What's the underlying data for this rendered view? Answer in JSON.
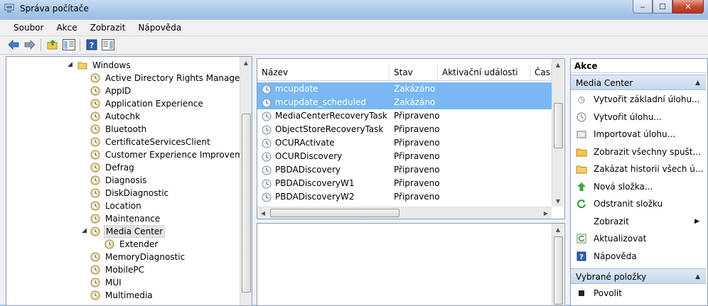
{
  "window": {
    "title": "Správa počítače",
    "min": "‒",
    "max": "☐",
    "close": "✕"
  },
  "menu": [
    "Soubor",
    "Akce",
    "Zobrazit",
    "Nápověda"
  ],
  "tree": {
    "root": "Windows",
    "items": [
      "Active Directory Rights Managemer",
      "AppID",
      "Application Experience",
      "Autochk",
      "Bluetooth",
      "CertificateServicesClient",
      "Customer Experience Improvement",
      "Defrag",
      "Diagnosis",
      "DiskDiagnostic",
      "Location",
      "Maintenance",
      "Media Center",
      "Extender",
      "MemoryDiagnostic",
      "MobilePC",
      "MUI",
      "Multimedia"
    ]
  },
  "list": {
    "columns": [
      "Název",
      "Stav",
      "Aktivační události",
      "Čas"
    ],
    "rows": [
      {
        "name": "mcupdate",
        "status": "Zakázáno"
      },
      {
        "name": "mcupdate_scheduled",
        "status": "Zakázáno"
      },
      {
        "name": "MediaCenterRecoveryTask",
        "status": "Připraveno"
      },
      {
        "name": "ObjectStoreRecoveryTask",
        "status": "Připraveno"
      },
      {
        "name": "OCURActivate",
        "status": "Připraveno"
      },
      {
        "name": "OCURDiscovery",
        "status": "Připraveno"
      },
      {
        "name": "PBDADiscovery",
        "status": "Připraveno"
      },
      {
        "name": "PBDADiscoveryW1",
        "status": "Připraveno"
      },
      {
        "name": "PBDADiscoveryW2",
        "status": "Připraveno"
      }
    ]
  },
  "actions": {
    "title": "Akce",
    "section1": "Media Center",
    "items1": [
      "Vytvořit základní úlohu...",
      "Vytvořit úlohu...",
      "Importovat úlohu...",
      "Zobrazit všechny spušt...",
      "Zakázat historii všech ú...",
      "Nová složka...",
      "Odstranit složku",
      "Zobrazit",
      "Aktualizovat",
      "Nápověda"
    ],
    "section2": "Vybrané položky",
    "items2": [
      "Povolit"
    ]
  },
  "colors": {
    "selection": "#79b8f5",
    "pane_border": "#8e9eb4",
    "section_bg": "#c6d8ee"
  }
}
